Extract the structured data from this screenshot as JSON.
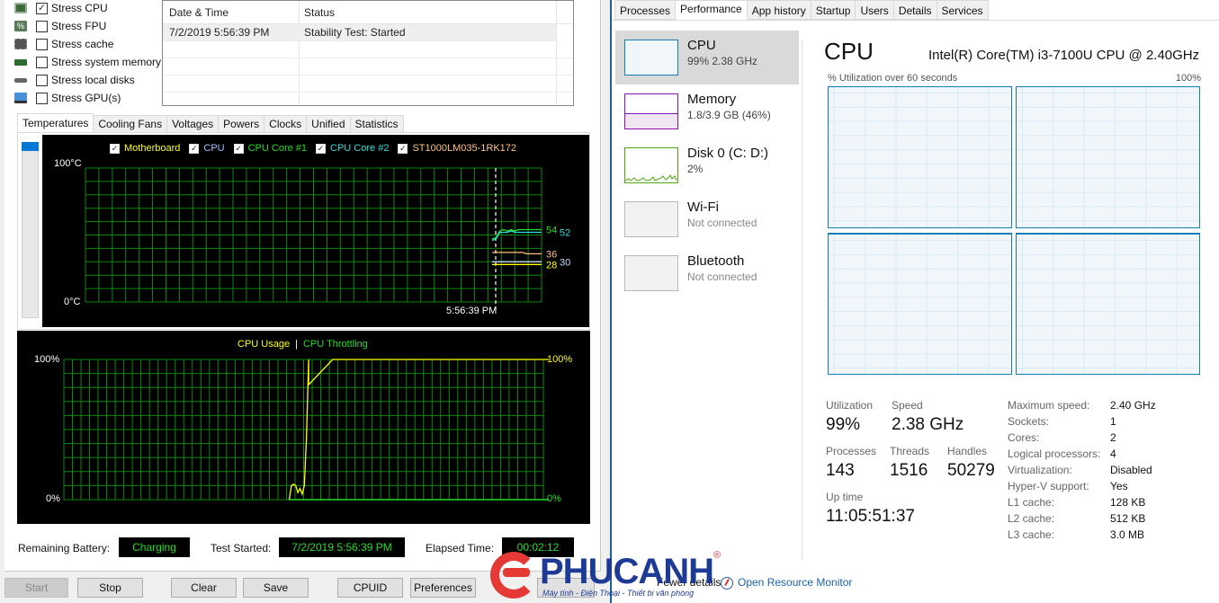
{
  "stress_options": [
    {
      "label": "Stress CPU",
      "checked": true,
      "icon": "cpu-chip-icon"
    },
    {
      "label": "Stress FPU",
      "checked": false,
      "icon": "fpu-percent-icon"
    },
    {
      "label": "Stress cache",
      "checked": false,
      "icon": "cache-chip-icon"
    },
    {
      "label": "Stress system memory",
      "checked": false,
      "icon": "memory-module-icon"
    },
    {
      "label": "Stress local disks",
      "checked": false,
      "icon": "disk-drive-icon"
    },
    {
      "label": "Stress GPU(s)",
      "checked": false,
      "icon": "gpu-monitor-icon"
    }
  ],
  "log": {
    "columns": [
      "Date & Time",
      "Status"
    ],
    "rows": [
      {
        "datetime": "7/2/2019 5:56:39 PM",
        "status": "Stability Test: Started"
      }
    ]
  },
  "graph_tabs": [
    "Temperatures",
    "Cooling Fans",
    "Voltages",
    "Powers",
    "Clocks",
    "Unified",
    "Statistics"
  ],
  "active_graph_tab": "Temperatures",
  "chart_data": [
    {
      "type": "line",
      "title": "Temperatures",
      "ylabel": "°C",
      "y_top_label": "100°C",
      "y_bottom_label": "0°C",
      "ylim": [
        0,
        100
      ],
      "x_marker_label": "5:56:39 PM",
      "grid": true,
      "legend": [
        {
          "name": "Motherboard",
          "color": "#ffff00",
          "checked": true
        },
        {
          "name": "CPU",
          "color": "#9fc3ff",
          "checked": true
        },
        {
          "name": "CPU Core #1",
          "color": "#22dd22",
          "checked": true
        },
        {
          "name": "CPU Core #2",
          "color": "#33dddd",
          "checked": true
        },
        {
          "name": "ST1000LM035-1RK172",
          "color": "#ffc080",
          "checked": true
        }
      ],
      "series": [
        {
          "name": "CPU Core #1",
          "color": "#22dd22",
          "values": [
            47,
            48,
            53,
            54,
            53,
            54,
            53,
            54,
            54,
            54,
            54,
            54,
            54,
            54
          ],
          "end_label": "54"
        },
        {
          "name": "CPU Core #2",
          "color": "#33dddd",
          "values": [
            46,
            47,
            52,
            52,
            52,
            53,
            52,
            52,
            52,
            52,
            52,
            52,
            52,
            52
          ],
          "end_label": "52"
        },
        {
          "name": "ST1000LM035-1RK172",
          "color": "#ffc080",
          "values": [
            37,
            37,
            37,
            37,
            37,
            37,
            37,
            37,
            37,
            36,
            36,
            36,
            36,
            36
          ],
          "end_label": "36"
        },
        {
          "name": "CPU",
          "color": "#c8d8ff",
          "values": [
            30,
            30,
            30,
            30,
            30,
            30,
            30,
            30,
            30,
            30,
            30,
            30,
            30,
            30
          ],
          "end_label": "30"
        },
        {
          "name": "Motherboard",
          "color": "#ffff00",
          "values": [
            28,
            28,
            28,
            28,
            28,
            28,
            28,
            28,
            28,
            28,
            28,
            28,
            28,
            28
          ],
          "end_label": "28"
        }
      ]
    },
    {
      "type": "line",
      "title": "CPU Usage | CPU Throttling",
      "legend": [
        {
          "name": "CPU Usage",
          "color": "#ffff00"
        },
        {
          "name": "CPU Throttling",
          "color": "#22dd22"
        }
      ],
      "ylim": [
        0,
        100
      ],
      "y_top_label_left": "100%",
      "y_bottom_label_left": "0%",
      "y_top_label_right": "100%",
      "y_bottom_label_right": "0%",
      "grid": true,
      "series": [
        {
          "name": "CPU Usage",
          "color": "#ffff00",
          "start_fraction": 0.47,
          "values": [
            0,
            10,
            11,
            10,
            5,
            8,
            4,
            10,
            45,
            82,
            100,
            100,
            100,
            100,
            100,
            100,
            100,
            100,
            100,
            100
          ]
        },
        {
          "name": "CPU Throttling",
          "color": "#22dd22",
          "start_fraction": 0.47,
          "values": [
            0,
            0
          ]
        }
      ]
    }
  ],
  "status": {
    "battery_label": "Remaining Battery:",
    "battery_value": "Charging",
    "started_label": "Test Started:",
    "started_value": "7/2/2019 5:56:39 PM",
    "elapsed_label": "Elapsed Time:",
    "elapsed_value": "00:02:12"
  },
  "buttons": {
    "start": "Start",
    "stop": "Stop",
    "clear": "Clear",
    "save": "Save",
    "cpuid": "CPUID",
    "preferences": "Preferences"
  },
  "task_manager": {
    "tabs": [
      "Processes",
      "Performance",
      "App history",
      "Startup",
      "Users",
      "Details",
      "Services"
    ],
    "active_tab": "Performance",
    "resources": [
      {
        "name": "CPU",
        "sub": "99%  2.38 GHz",
        "color": "#117dbb"
      },
      {
        "name": "Memory",
        "sub": "1.8/3.9 GB (46%)",
        "color": "#8b12ae",
        "fill_fraction": 0.46
      },
      {
        "name": "Disk 0 (C: D:)",
        "sub": "2%",
        "color": "#4da60c"
      },
      {
        "name": "Wi-Fi",
        "sub": "Not connected",
        "color": "#b0b0b0"
      },
      {
        "name": "Bluetooth",
        "sub": "Not connected",
        "color": "#b0b0b0"
      }
    ],
    "cpu_title": "CPU",
    "cpu_model": "Intel(R) Core(TM) i3-7100U CPU @ 2.40GHz",
    "util_caption": "% Utilization over 60 seconds",
    "util_max": "100%",
    "stats": {
      "utilization_label": "Utilization",
      "utilization": "99%",
      "speed_label": "Speed",
      "speed": "2.38 GHz",
      "processes_label": "Processes",
      "processes": "143",
      "threads_label": "Threads",
      "threads": "1516",
      "handles_label": "Handles",
      "handles": "50279",
      "uptime_label": "Up time",
      "uptime": "11:05:51:37"
    },
    "specs": [
      {
        "label": "Maximum speed:",
        "value": "2.40 GHz"
      },
      {
        "label": "Sockets:",
        "value": "1"
      },
      {
        "label": "Cores:",
        "value": "2"
      },
      {
        "label": "Logical processors:",
        "value": "4"
      },
      {
        "label": "Virtualization:",
        "value": "Disabled"
      },
      {
        "label": "Hyper-V support:",
        "value": "Yes"
      },
      {
        "label": "L1 cache:",
        "value": "128 KB"
      },
      {
        "label": "L2 cache:",
        "value": "512 KB"
      },
      {
        "label": "L3 cache:",
        "value": "3.0 MB"
      }
    ],
    "fewer_details": "Fewer details",
    "open_resource_monitor": "Open Resource Monitor"
  },
  "watermark": {
    "brand": "PHUCANH",
    "registered": "®",
    "tagline": "Máy tính - Điện Thoại - Thiết bị văn phòng"
  }
}
